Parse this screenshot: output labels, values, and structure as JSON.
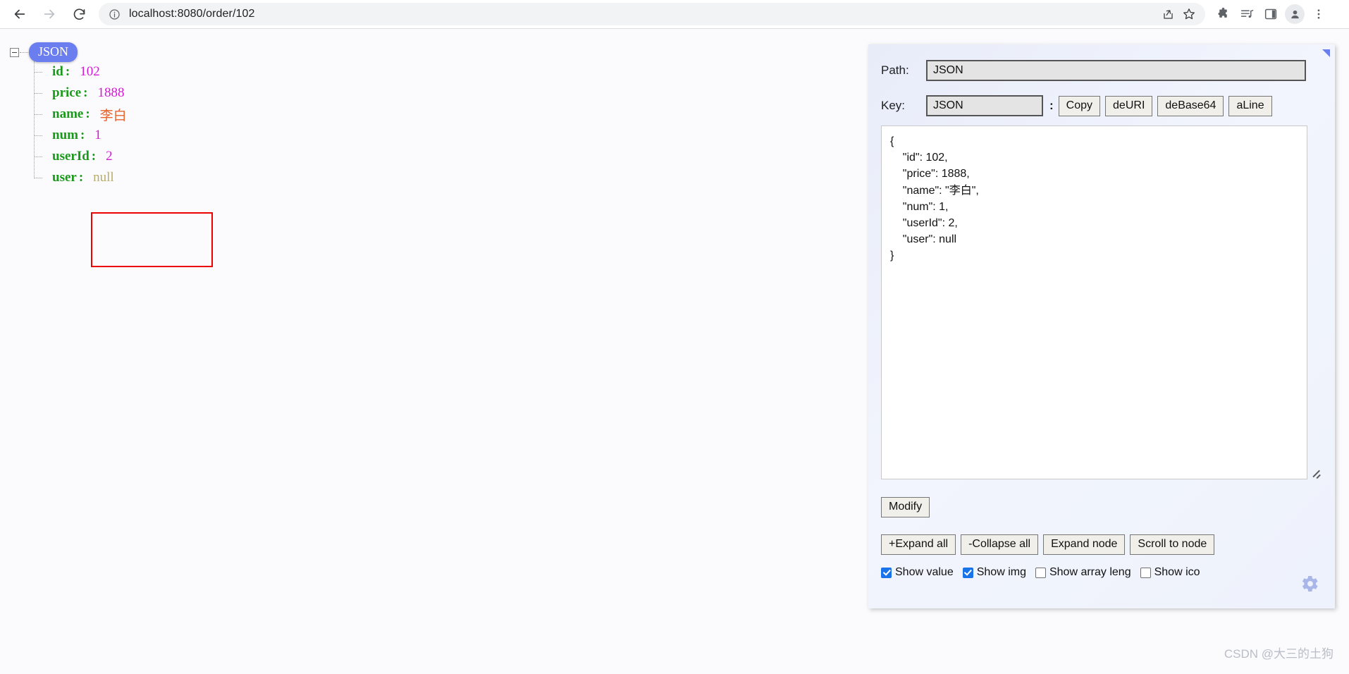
{
  "browser": {
    "url": "localhost:8080/order/102",
    "nav": {
      "back_label": "back-arrow",
      "forward_label": "forward-arrow",
      "reload_label": "reload"
    },
    "omnibox_icons": [
      "site-info-icon",
      "share-icon",
      "bookmark-star-icon"
    ],
    "toolbar_icons": [
      "extensions-puzzle-icon",
      "media-playlist-icon",
      "side-panel-icon",
      "profile-avatar-icon",
      "chrome-menu-icon"
    ]
  },
  "tree": {
    "root_label": "JSON",
    "toggle": "collapse-minus",
    "nodes": [
      {
        "key": "id",
        "colon": ":",
        "value": "102",
        "type": "num"
      },
      {
        "key": "price",
        "colon": ":",
        "value": "1888",
        "type": "num"
      },
      {
        "key": "name",
        "colon": ":",
        "value": "李白",
        "type": "str"
      },
      {
        "key": "num",
        "colon": ":",
        "value": "1",
        "type": "num"
      },
      {
        "key": "userId",
        "colon": ":",
        "value": "2",
        "type": "num"
      },
      {
        "key": "user",
        "colon": ":",
        "value": "null",
        "type": "null"
      }
    ]
  },
  "annotation": {
    "shape": "red-rectangle",
    "color": "#ef0000"
  },
  "panel": {
    "path": {
      "label": "Path:",
      "value": "JSON",
      "placeholder": ""
    },
    "key": {
      "label": "Key:",
      "value": "JSON",
      "placeholder": "",
      "separator": ":"
    },
    "key_buttons": [
      {
        "label": "Copy"
      },
      {
        "label": "deURI"
      },
      {
        "label": "deBase64"
      },
      {
        "label": "aLine"
      }
    ],
    "textarea": {
      "value": "{\n    \"id\": 102,\n    \"price\": 1888,\n    \"name\": \"李白\",\n    \"num\": 1,\n    \"userId\": 2,\n    \"user\": null\n}",
      "placeholder": ""
    },
    "modify_button": {
      "label": "Modify"
    },
    "action_buttons": [
      {
        "label": "+Expand all"
      },
      {
        "label": "-Collapse all"
      },
      {
        "label": "Expand node"
      },
      {
        "label": "Scroll to node"
      }
    ],
    "checkboxes": [
      {
        "label": "Show value",
        "checked": true
      },
      {
        "label": "Show img",
        "checked": true
      },
      {
        "label": "Show array leng",
        "checked": false
      },
      {
        "label": "Show ico",
        "checked": false
      }
    ],
    "gear": "settings-gear-icon",
    "corner_handle": "panel-resize-handle",
    "accent_color": "#6b7ef0",
    "checkbox_color": "#1a73e8"
  },
  "watermark": {
    "text": "CSDN @大三的土狗"
  }
}
